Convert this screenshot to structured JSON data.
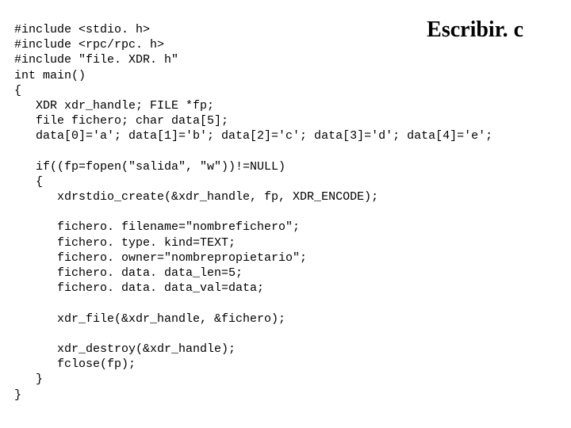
{
  "title": "Escribir. c",
  "code": "#include <stdio. h>\n#include <rpc/rpc. h>\n#include \"file. XDR. h\"\nint main()\n{\n   XDR xdr_handle; FILE *fp;\n   file fichero; char data[5];\n   data[0]='a'; data[1]='b'; data[2]='c'; data[3]='d'; data[4]='e';\n\n   if((fp=fopen(\"salida\", \"w\"))!=NULL)\n   {\n      xdrstdio_create(&xdr_handle, fp, XDR_ENCODE);\n\n      fichero. filename=\"nombrefichero\";\n      fichero. type. kind=TEXT;\n      fichero. owner=\"nombrepropietario\";\n      fichero. data. data_len=5;\n      fichero. data. data_val=data;\n\n      xdr_file(&xdr_handle, &fichero);\n\n      xdr_destroy(&xdr_handle);\n      fclose(fp);\n   }\n}"
}
